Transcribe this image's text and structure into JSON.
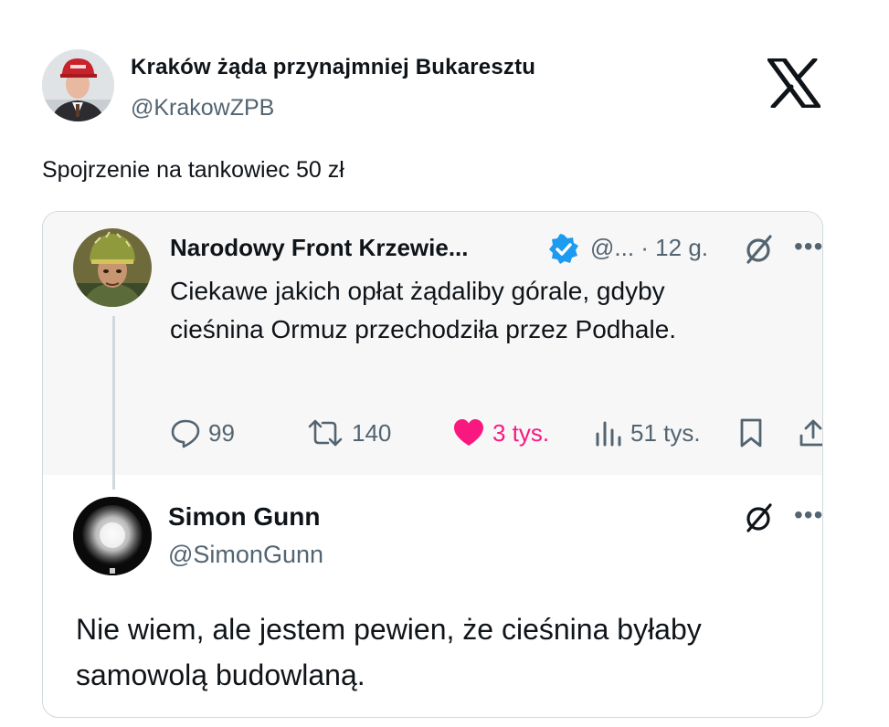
{
  "tweet": {
    "author_name": "Kraków żąda przynajmniej Bukaresztu",
    "author_handle": "@KrakowZPB",
    "text": "Spojrzenie na tankowiec 50 zł",
    "platform_icon": "x-logo-icon"
  },
  "quoted_tweet": {
    "author_name": "Narodowy Front Krzewie...",
    "meta": "@... · 12 g.",
    "text": "Ciekawe jakich opłat żądaliby górale, gdyby cieśnina Ormuz przechodziła przez Podhale.",
    "actions": {
      "replies": "99",
      "reposts": "140",
      "likes": "3 tys.",
      "views": "51 tys."
    },
    "colors": {
      "like": "#f91880",
      "verified": "#1d9bf0",
      "muted": "#536471"
    }
  },
  "reply": {
    "author_name": "Simon Gunn",
    "author_handle": "@SimonGunn",
    "text": "Nie wiem, ale jestem pewien, że cieśnina byłaby samowolą budowlaną."
  }
}
